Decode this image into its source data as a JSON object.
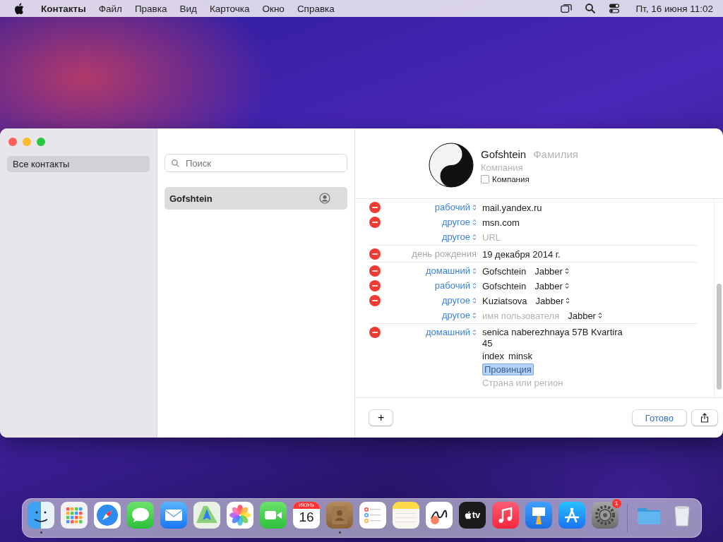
{
  "menu_bar": {
    "app": "Контакты",
    "menus": [
      "Файл",
      "Правка",
      "Вид",
      "Карточка",
      "Окно",
      "Справка"
    ],
    "clock": "Пт, 16 июня  11:02"
  },
  "sidebar": {
    "items": [
      {
        "label": "Все контакты",
        "selected": true
      }
    ]
  },
  "contact_list": {
    "search": {
      "placeholder": "Поиск"
    },
    "items": [
      {
        "name": "Gofshtein",
        "selected": true
      }
    ]
  },
  "card": {
    "first_name": "Gofshtein",
    "last_name_placeholder": "Фамилия",
    "company_placeholder": "Компания",
    "company_checkbox": {
      "label": "Компания",
      "checked": false
    },
    "groups": [
      {
        "rows": [
          {
            "removable": true,
            "label": "рабочий",
            "popup": true,
            "value": "mail.yandex.ru"
          },
          {
            "removable": true,
            "label": "другое",
            "popup": true,
            "value": "msn.com"
          },
          {
            "removable": false,
            "label": "другое",
            "popup": true,
            "placeholder": "URL"
          }
        ]
      },
      {
        "rows": [
          {
            "removable": true,
            "label": "день рождения",
            "popup": false,
            "value": "19 декабря 2014 г."
          }
        ]
      },
      {
        "rows": [
          {
            "removable": true,
            "label": "домашний",
            "popup": true,
            "value": "Gofschtein",
            "service": "Jabber"
          },
          {
            "removable": true,
            "label": "рабочий",
            "popup": true,
            "value": "Gofschtein",
            "service": "Jabber"
          },
          {
            "removable": true,
            "label": "другое",
            "popup": true,
            "value": "Kuziatsova",
            "service": "Jabber"
          },
          {
            "removable": false,
            "label": "другое",
            "popup": true,
            "placeholder": "имя пользователя",
            "service": "Jabber"
          }
        ]
      },
      {
        "rows": [
          {
            "removable": true,
            "label": "домашний",
            "popup": true,
            "lines": [
              {
                "parts": [
                  {
                    "value": "senica naberezhnaya 57B Kvartira 45"
                  }
                ]
              },
              {
                "parts": [
                  {
                    "value": "index"
                  },
                  {
                    "value": "minsk"
                  }
                ]
              },
              {
                "parts": [
                  {
                    "placeholder": "Провинция",
                    "selected": true
                  }
                ]
              },
              {
                "parts": [
                  {
                    "placeholder": "Страна или регион",
                    "selected": false
                  }
                ]
              }
            ]
          }
        ]
      }
    ],
    "done_button": "Готово",
    "add_button": "+"
  },
  "dock": [
    {
      "kind": "finder",
      "running": true
    },
    {
      "kind": "launchpad",
      "running": false
    },
    {
      "kind": "safari",
      "running": false
    },
    {
      "kind": "messages",
      "running": false
    },
    {
      "kind": "mail",
      "running": false
    },
    {
      "kind": "maps",
      "running": false
    },
    {
      "kind": "photos",
      "running": false
    },
    {
      "kind": "facetime",
      "running": false
    },
    {
      "kind": "calendar",
      "running": false,
      "month": "ИЮНЬ",
      "day": "16"
    },
    {
      "kind": "contacts",
      "running": true
    },
    {
      "kind": "reminders",
      "running": false
    },
    {
      "kind": "notes",
      "running": false
    },
    {
      "kind": "freeform",
      "running": false
    },
    {
      "kind": "tv",
      "running": false,
      "label": "tv"
    },
    {
      "kind": "music",
      "running": false
    },
    {
      "kind": "keynote",
      "running": false
    },
    {
      "kind": "appstore",
      "running": false
    },
    {
      "kind": "settings",
      "running": false,
      "badge": "1"
    },
    {
      "kind": "separator"
    },
    {
      "kind": "folder",
      "running": false
    },
    {
      "kind": "trash",
      "running": false
    }
  ]
}
